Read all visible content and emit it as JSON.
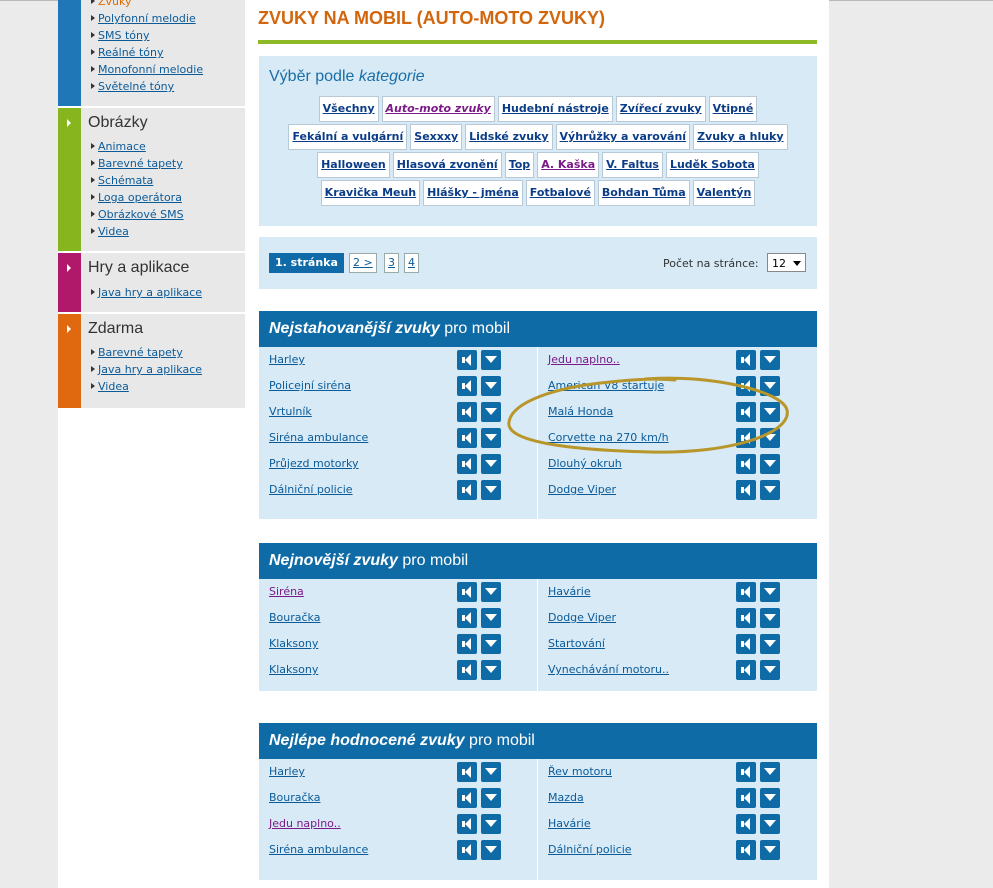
{
  "sidebar": {
    "zvuky": {
      "items": [
        "Zvuky",
        "Polyfonní melodie",
        "SMS tóny",
        "Reálné tóny",
        "Monofonní melodie",
        "Světelné tóny"
      ],
      "color": "#1f77b8"
    },
    "obrazky": {
      "title": "Obrázky",
      "items": [
        "Animace",
        "Barevné tapety",
        "Schémata",
        "Loga operátora",
        "Obrázkové SMS",
        "Videa"
      ],
      "color": "#87b51d"
    },
    "hry": {
      "title": "Hry a aplikace",
      "items": [
        "Java hry a aplikace"
      ],
      "color": "#b0196a"
    },
    "zdarma": {
      "title": "Zdarma",
      "items": [
        "Barevné tapety",
        "Java hry a aplikace",
        "Videa"
      ],
      "color": "#e0680f"
    }
  },
  "page_title": "ZVUKY NA MOBIL (AUTO-MOTO ZVUKY)",
  "categories": {
    "heading_prefix": "Výběr podle",
    "heading_em": "kategorie",
    "rows": [
      [
        "Všechny",
        "Auto-moto zvuky",
        "Hudební nástroje",
        "Zvířecí zvuky",
        "Vtipné"
      ],
      [
        "Fekální a vulgární",
        "Sexxxy",
        "Lidské zvuky",
        "Výhrůžky a varování",
        "Zvuky a hluky"
      ],
      [
        "Halloween",
        "Hlasová zvonění",
        "Top",
        "A. Kaška",
        "V. Faltus",
        "Luděk Sobota"
      ],
      [
        "Kravička Meuh",
        "Hlášky - jména",
        "Fotbalové",
        "Bohdan Tůma",
        "Valentýn"
      ]
    ],
    "selected": "Auto-moto zvuky"
  },
  "pagination": {
    "current": "1. stránka",
    "next": "2 >",
    "pages": [
      "3",
      "4"
    ],
    "per_page_label": "Počet na stránce:",
    "per_page_value": "12"
  },
  "sections": [
    {
      "title_em": "Nejstahovanější zvuky",
      "title_rest": " pro mobil",
      "left": [
        "Harley",
        "Policejní siréna",
        "Vrtulník",
        "Siréna ambulance",
        "Průjezd motorky",
        "Dálniční policie"
      ],
      "right": [
        "Jedu naplno..",
        "American V8 startuje",
        "Malá Honda",
        "Corvette na 270 km/h",
        "Dlouhý okruh",
        "Dodge Viper"
      ]
    },
    {
      "title_em": "Nejnovější zvuky",
      "title_rest": " pro mobil",
      "left": [
        "Siréna",
        "Bouračka",
        "Klaksony",
        "Klaksony"
      ],
      "right": [
        "Havárie",
        "Dodge Viper",
        "Startování",
        "Vynechávání motoru.."
      ]
    },
    {
      "title_em": "Nejlépe hodnocené zvuky",
      "title_rest": " pro mobil",
      "left": [
        "Harley",
        "Bouračka",
        "Jedu naplno..",
        "Siréna ambulance"
      ],
      "right": [
        "Řev motoru",
        "Mazda",
        "Havárie",
        "Dálniční policie"
      ]
    }
  ],
  "annotation_color": "#b8962a"
}
